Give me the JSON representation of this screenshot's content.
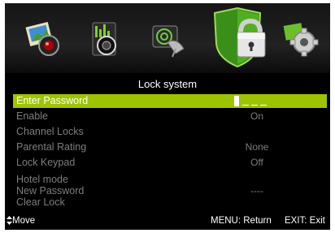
{
  "menu_title": "Lock system",
  "icons": [
    "picture-icon",
    "sound-icon",
    "channel-icon",
    "lock-icon",
    "settings-icon"
  ],
  "selected_icon": "lock-icon",
  "items": [
    {
      "label": "Enter Password",
      "value": "",
      "active": true
    },
    {
      "label": "Enable",
      "value": "On"
    },
    {
      "label": "Channel Locks",
      "value": ""
    },
    {
      "label": "Parental Rating",
      "value": "None"
    },
    {
      "label": "Lock Keypad",
      "value": "Off"
    },
    {
      "label": "Hotel mode",
      "value": ""
    },
    {
      "label": "New Password",
      "value": "----"
    },
    {
      "label": "Clear Lock",
      "value": ""
    }
  ],
  "password_dashes": "_ _ _",
  "footer": {
    "move": "Move",
    "menu": "MENU: Return",
    "exit": "EXIT: Exit"
  },
  "colors": {
    "highlight": "#9dc400",
    "disabled_text": "#7d7d7d",
    "background": "#000000"
  }
}
